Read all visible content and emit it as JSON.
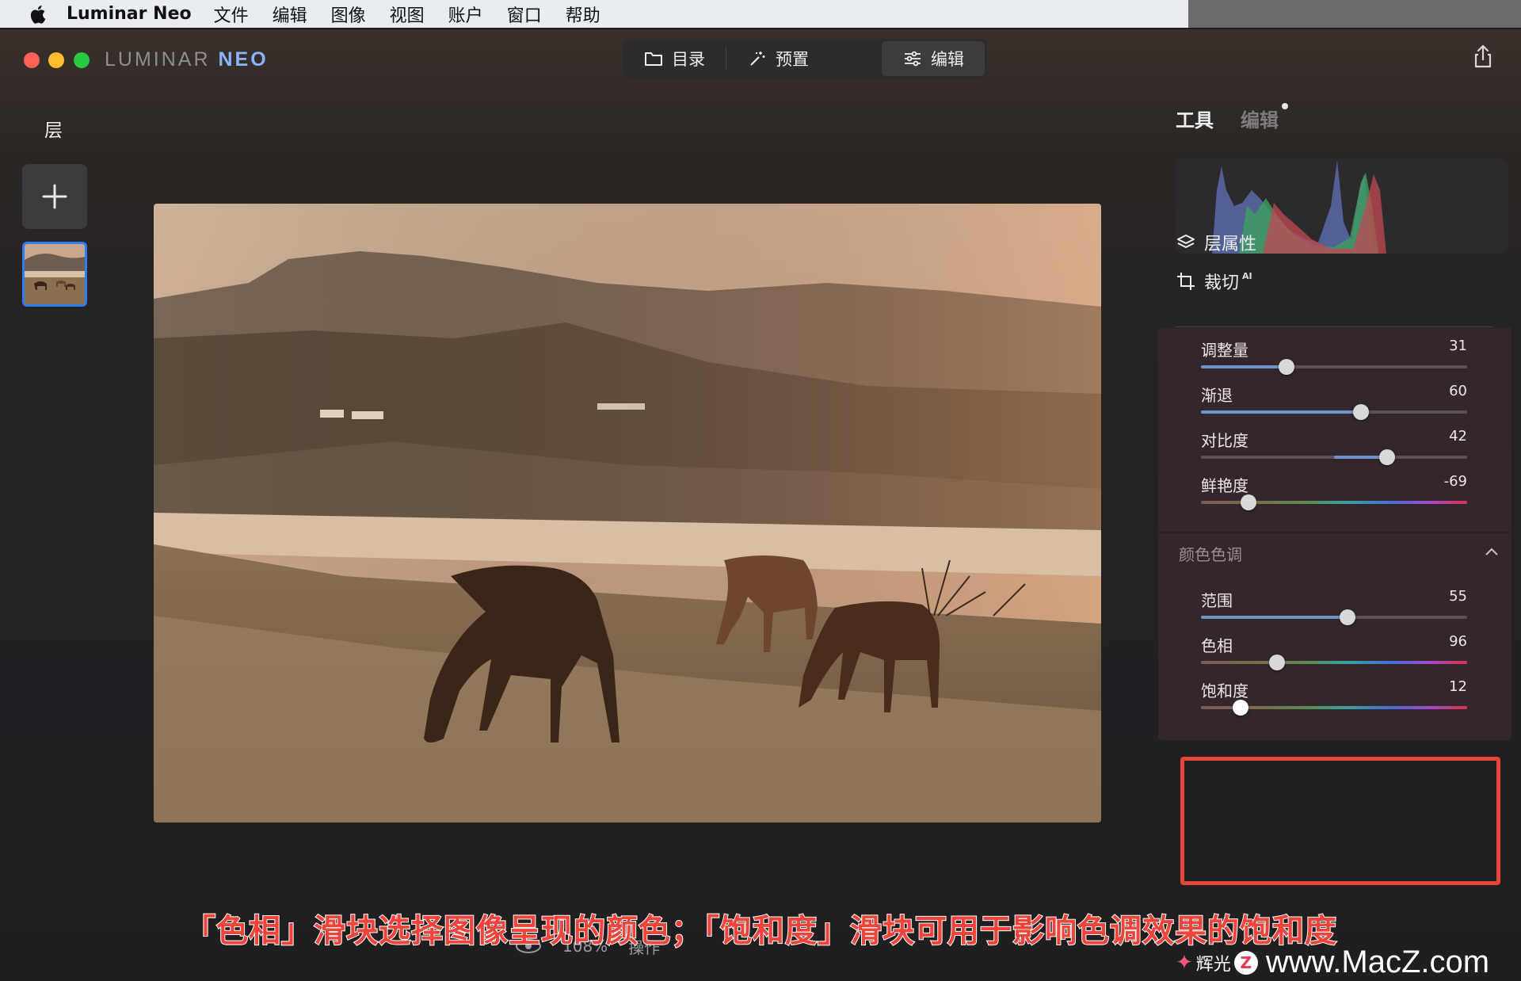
{
  "menubar": {
    "app_name": "Luminar Neo",
    "items": [
      "文件",
      "编辑",
      "图像",
      "视图",
      "账户",
      "窗口",
      "帮助"
    ]
  },
  "window": {
    "brand_left": "LUMINAR ",
    "brand_right": "NEO",
    "modes": [
      {
        "label": "目录",
        "icon": "folder-icon",
        "active": false
      },
      {
        "label": "预置",
        "icon": "magic-wand-icon",
        "active": false
      },
      {
        "label": "编辑",
        "icon": "sliders-icon",
        "active": true
      }
    ]
  },
  "layers": {
    "title": "层"
  },
  "bottom_bar": {
    "zoom": "108%",
    "actions": "操作"
  },
  "right_panel": {
    "tabs": {
      "tools": "工具",
      "edits": "编辑"
    },
    "tools": [
      {
        "label": "层属性",
        "icon": "layers-icon"
      },
      {
        "label": "裁切",
        "icon": "crop-icon",
        "badge": "AI"
      }
    ],
    "sliders_top": [
      {
        "label": "调整量",
        "value": "31",
        "position": 0.32
      },
      {
        "label": "渐退",
        "value": "60",
        "position": 0.6
      },
      {
        "label": "对比度",
        "value": "42",
        "position": 0.7
      },
      {
        "label": "鲜艳度",
        "value": "-69",
        "position": 0.18
      }
    ],
    "section": {
      "title": "颜色色调"
    },
    "sliders_color": [
      {
        "label": "范围",
        "value": "55",
        "position": 0.55
      },
      {
        "label": "色相",
        "value": "96",
        "position": 0.285
      },
      {
        "label": "饱和度",
        "value": "12",
        "position": 0.15
      }
    ]
  },
  "caption": "「色相」滑块选择图像呈现的颜色；「饱和度」滑块可用于影响色调效果的饱和度",
  "watermark": {
    "badge": "辉光",
    "url": "www.MacZ.com"
  }
}
